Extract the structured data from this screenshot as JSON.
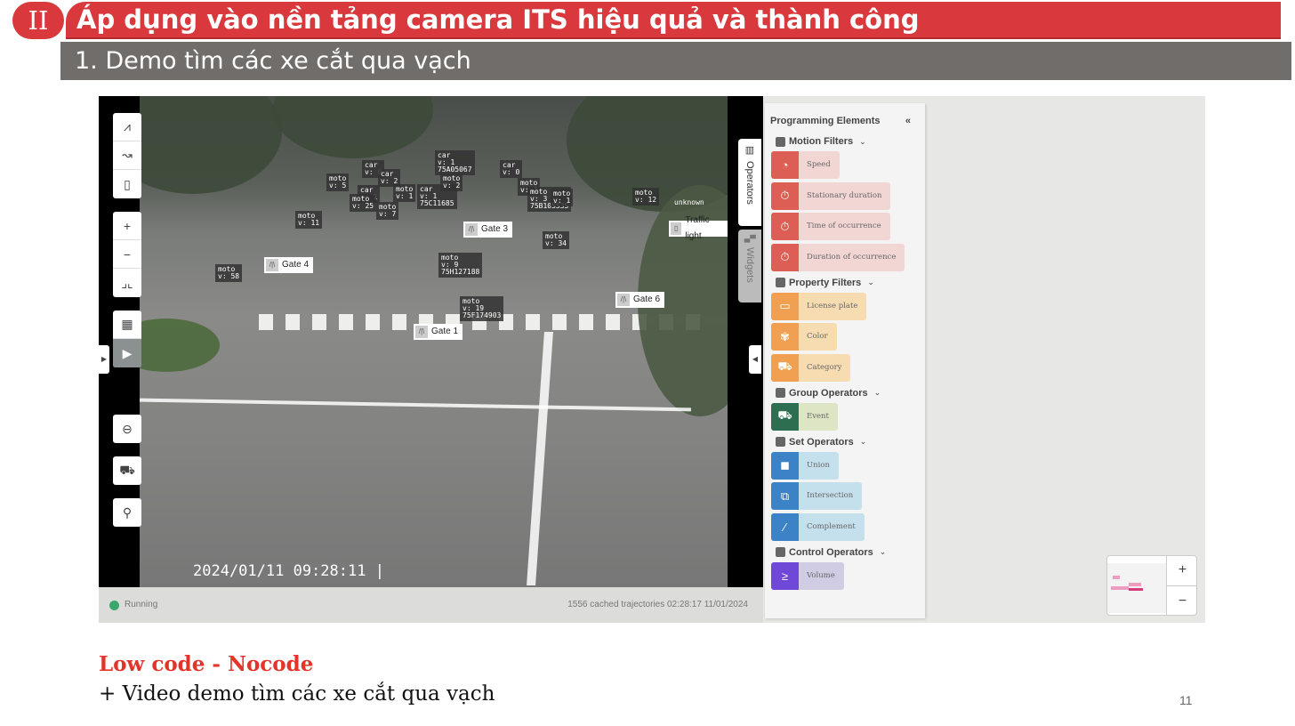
{
  "slide": {
    "section_number": "II",
    "title": "Áp dụng vào nền tảng camera ITS hiệu quả và thành công",
    "subtitle": "1. Demo tìm các xe cắt qua vạch",
    "heading": "Low code - Nocode",
    "bullet": "+ Video demo tìm các xe cắt qua vạch",
    "page_number": "11"
  },
  "video": {
    "timestamp": "2024/01/11 09:28:11 |",
    "gates": [
      "Gate 1",
      "Gate 3",
      "Gate 4",
      "Gate 6"
    ],
    "traffic_light_label": "Traffic light",
    "tracks": [
      "moto\nv: 5",
      "car\nv: 1",
      "car\nv: 0",
      "car\nv: 2",
      "moto\nv: 25",
      "moto\nv: 1",
      "moto\nv: 7",
      "car\nv: 1\n75C11685",
      "car\nv: 1\n75A05067",
      "moto\nv: 2",
      "car\nv: 0",
      "moto\nv: 2",
      "moto\nv: 3\n75B105535",
      "moto\nv: 1",
      "moto\nv: 11",
      "moto\nv: 12",
      "moto\nv: 34",
      "moto\nv: 58",
      "moto\nv: 9\n75H127188",
      "moto\nv: 19\n75F174903",
      "unknown"
    ]
  },
  "status": {
    "state": "Running",
    "state_color": "#3aa76d",
    "info": "1556 cached trajectories 02:28:17 11/01/2024"
  },
  "tabs": {
    "operators": "Operators",
    "widgets": "Widgets"
  },
  "panel": {
    "title": "Programming Elements",
    "collapse_icon": "«",
    "categories": [
      {
        "label": "Motion Filters",
        "color": "#dc5e55",
        "bg": "#f2d6d4",
        "items": [
          "Speed",
          "Stationary duration",
          "Time of occurrence",
          "Duration of occurrence"
        ]
      },
      {
        "label": "Property Filters",
        "color": "#f0a050",
        "bg": "#f6dcb0",
        "items": [
          "License plate",
          "Color",
          "Category"
        ]
      },
      {
        "label": "Group Operators",
        "color": "#2e6e50",
        "bg": "#dde5c4",
        "items": [
          "Event"
        ]
      },
      {
        "label": "Set Operators",
        "color": "#3b82c6",
        "bg": "#c5e0ed",
        "items": [
          "Union",
          "Intersection",
          "Complement"
        ]
      },
      {
        "label": "Control Operators",
        "color": "#7048d8",
        "bg": "#d0cce4",
        "items": [
          "Volume"
        ]
      }
    ]
  },
  "zoom": {
    "plus": "+",
    "minus": "−"
  }
}
